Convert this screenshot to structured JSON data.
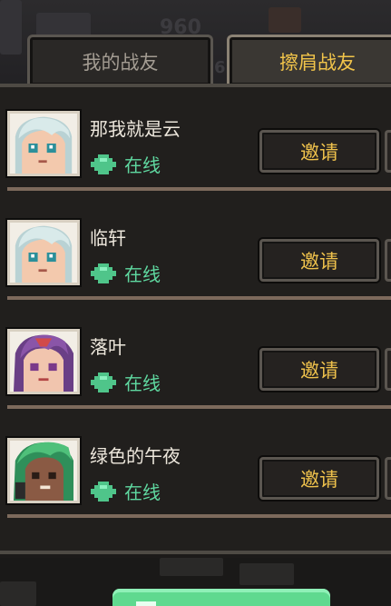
{
  "tabs": {
    "mine": "我的战友",
    "shoulder": "擦肩战友"
  },
  "background": {
    "ghost_left": "960",
    "ghost_right": "6"
  },
  "friends": [
    {
      "name": "那我就是云",
      "status": "在线",
      "invite": "邀请",
      "avatar": "silver-hair-avatar"
    },
    {
      "name": "临轩",
      "status": "在线",
      "invite": "邀请",
      "avatar": "silver-hair-avatar"
    },
    {
      "name": "落叶",
      "status": "在线",
      "invite": "邀请",
      "avatar": "purple-hair-avatar"
    },
    {
      "name": "绿色的午夜",
      "status": "在线",
      "invite": "邀请",
      "avatar": "green-hair-avatar"
    }
  ],
  "colors": {
    "online": "#5fd8a0",
    "invite_text": "#efc24c",
    "active_tab_text": "#f1c44a"
  }
}
